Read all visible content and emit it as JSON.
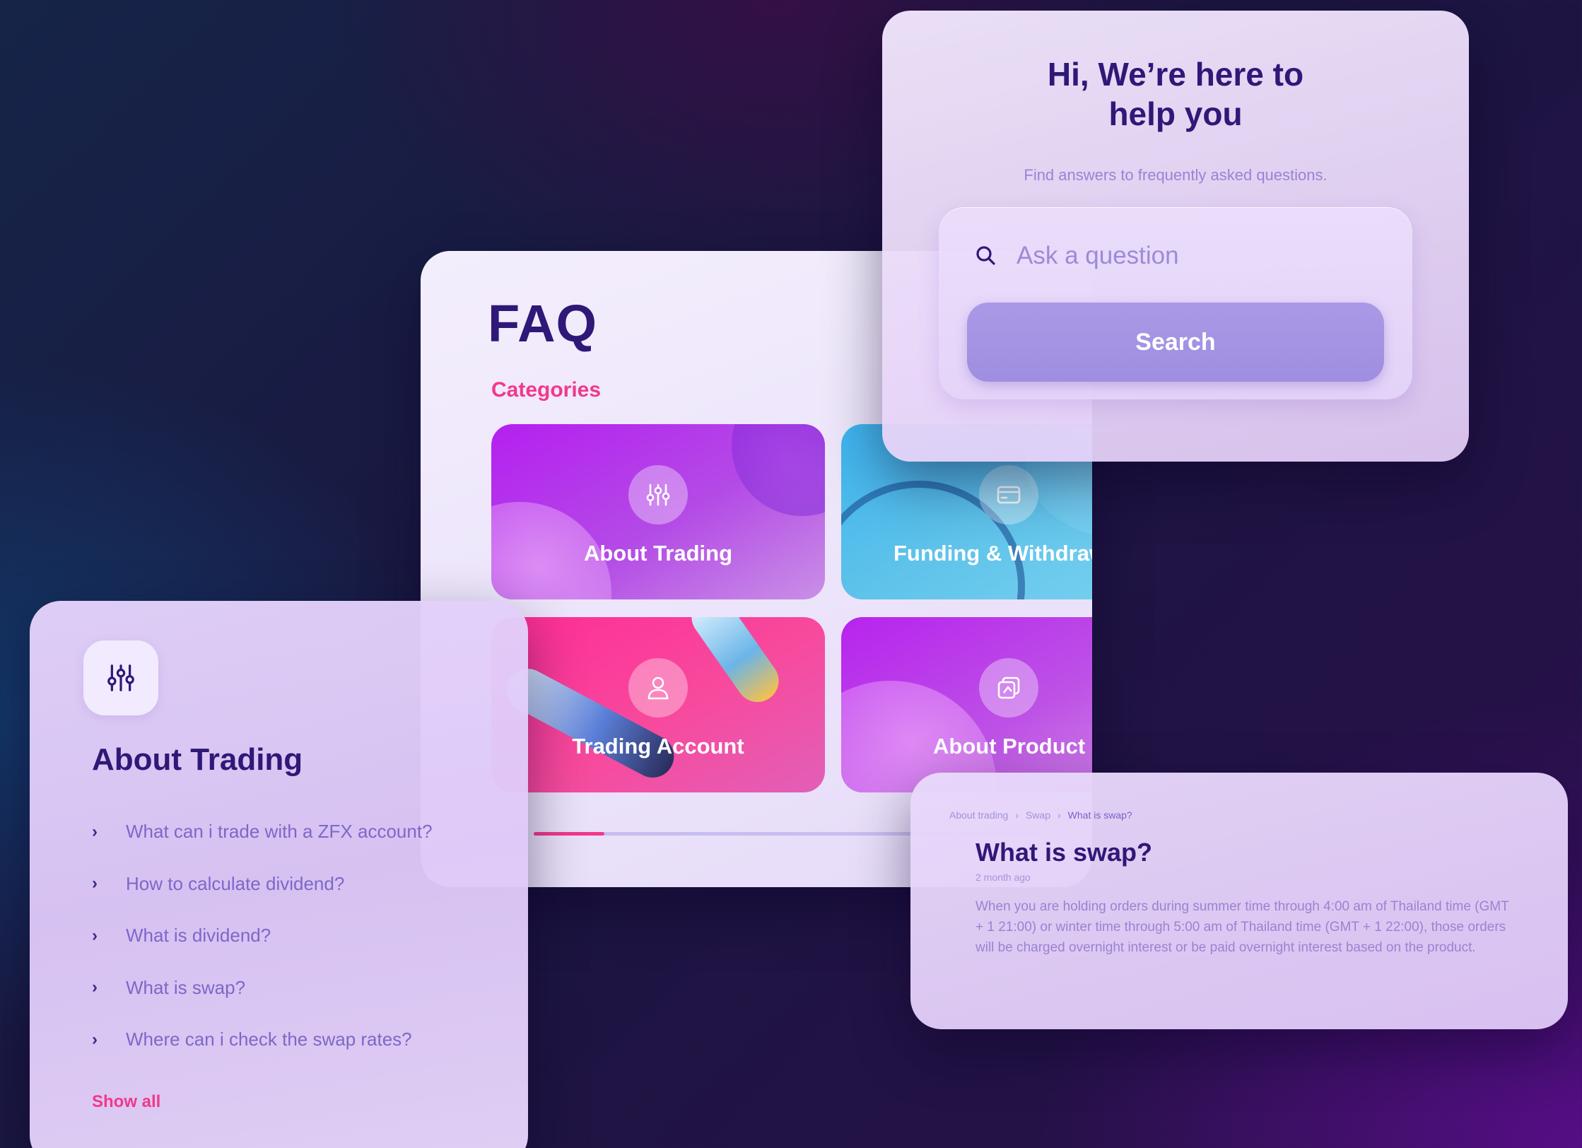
{
  "faq": {
    "title": "FAQ",
    "categories_label": "Categories",
    "categories": [
      {
        "label": "About Trading",
        "icon": "sliders-icon"
      },
      {
        "label": "Funding & Withdrawal",
        "icon": "card-icon"
      },
      {
        "label": "Trading Account",
        "icon": "user-icon"
      },
      {
        "label": "About Product",
        "icon": "layers-icon"
      }
    ]
  },
  "help": {
    "title_line1": "Hi, We’re here to",
    "title_line2": "help you",
    "subtitle": "Find answers to frequently asked questions.",
    "search_placeholder": "Ask a question",
    "search_button": "Search"
  },
  "trading": {
    "title": "About Trading",
    "questions": [
      "What can i trade with a ZFX account?",
      "How to calculate dividend?",
      "What is dividend?",
      "What is swap?",
      "Where can i check the swap rates?"
    ],
    "show_all": "Show all"
  },
  "article": {
    "breadcrumb": [
      "About trading",
      "Swap",
      "What is swap?"
    ],
    "title": "What is swap?",
    "time": "2 month ago",
    "body": "When you are holding orders during summer time through 4:00 am of Thailand time (GMT + 1 21:00) or winter time through 5:00 am of Thailand time (GMT + 1 22:00), those orders will be charged overnight interest or be paid overnight interest based on the product."
  },
  "colors": {
    "brand_dark": "#2f1877",
    "accent_pink": "#f2388c",
    "button_purple": "#a999e6",
    "card_trading": "#b51ff0",
    "card_funding": "#3db4ef",
    "card_account": "#ff2c95",
    "card_product": "#b723ee"
  }
}
